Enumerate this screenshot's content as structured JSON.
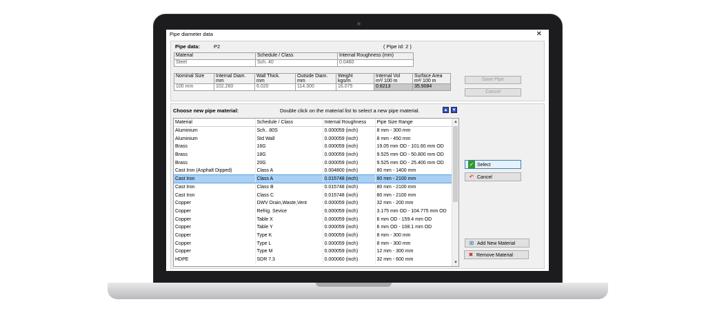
{
  "dialog": {
    "title": "Pipe diameter data",
    "close_glyph": "✕"
  },
  "pipe": {
    "label": "Pipe data:",
    "name": "P2",
    "id_text": "( Pipe Id: 2 )",
    "material_headers": [
      "Material",
      "Schedule / Class",
      "Internal Roughness (mm)"
    ],
    "material_values": [
      "Steel",
      "Sch. 40",
      "0.0460"
    ],
    "size_headers": [
      [
        "Nominal Size",
        ""
      ],
      [
        "Internal Diam.",
        "mm"
      ],
      [
        "Wall Thick.",
        "mm"
      ],
      [
        "Outside Diam.",
        "mm"
      ],
      [
        "Weight",
        "kgs/m"
      ],
      [
        "Internal Vol",
        "m³/ 100 m"
      ],
      [
        "Surface Area",
        "m²/ 100 m"
      ]
    ],
    "size_values": [
      "100 mm",
      "102.260",
      "6.020",
      "114.300",
      "16.075",
      "0.8213",
      "35.9084"
    ],
    "save_label": "Save Pipe",
    "cancel_label": "Cancel"
  },
  "material_list": {
    "heading": "Choose new pipe material:",
    "hint": "Double click on the material list to select a new pipe material.",
    "columns": [
      "Material",
      "Schedule / Class",
      "Internal Roughness",
      "Pipe Size Range"
    ],
    "selected_index": 6,
    "rows": [
      [
        "Aluminium",
        "Sch.. 80S",
        "0.000059 (inch)",
        "8 mm - 300 mm"
      ],
      [
        "Aluminium",
        "Std Wall",
        "0.000059 (inch)",
        "8 mm - 450 mm"
      ],
      [
        "Brass",
        "16G",
        "0.000059 (inch)",
        "19.05 mm OD - 101.60 mm OD"
      ],
      [
        "Brass",
        "18G",
        "0.000059 (inch)",
        "9.525 mm OD - 50.800 mm OD"
      ],
      [
        "Brass",
        "20G",
        "0.000059 (inch)",
        "9.525 mm OD - 25.400 mm OD"
      ],
      [
        "Cast Iron (Asphalt Dipped)",
        "Class A",
        "0.004800 (inch)",
        "80 mm - 1400 mm"
      ],
      [
        "Cast Iron",
        "Class A",
        "0.015748 (inch)",
        "80 mm - 2100 mm"
      ],
      [
        "Cast Iron",
        "Class B",
        "0.015748 (inch)",
        "80 mm - 2100 mm"
      ],
      [
        "Cast Iron",
        "Class C",
        "0.015748 (inch)",
        "80 mm - 2100 mm"
      ],
      [
        "Copper",
        "DWV Drain,Waste,Vent",
        "0.000059 (inch)",
        "32 mm - 200 mm"
      ],
      [
        "Copper",
        "Refrig. Sevice",
        "0.000059 (inch)",
        "3.175 mm OD - 104.775 mm OD"
      ],
      [
        "Copper",
        "Table X",
        "0.000059 (inch)",
        "6 mm OD - 159.4 mm OD"
      ],
      [
        "Copper",
        "Table Y",
        "0.000059 (inch)",
        "6 mm OD - 108.1 mm OD"
      ],
      [
        "Copper",
        "Type K",
        "0.000059 (inch)",
        "8 mm - 300 mm"
      ],
      [
        "Copper",
        "Type L",
        "0.000059 (inch)",
        "8 mm - 300 mm"
      ],
      [
        "Copper",
        "Type M",
        "0.000059 (inch)",
        "12 mm - 300 mm"
      ],
      [
        "HDPE",
        "SDR  7.3",
        "0.000060 (inch)",
        "32 mm - 600 mm"
      ]
    ]
  },
  "actions": {
    "select_label": "Select",
    "cancel_label": "Cancel",
    "add_label": "Add New Material",
    "remove_label": "Remove Material"
  },
  "colors": {
    "selection": "#a8d0f5",
    "accent": "#3355cc",
    "select_icon": "#2e9a2e",
    "cancel_icon": "#cc2222"
  }
}
